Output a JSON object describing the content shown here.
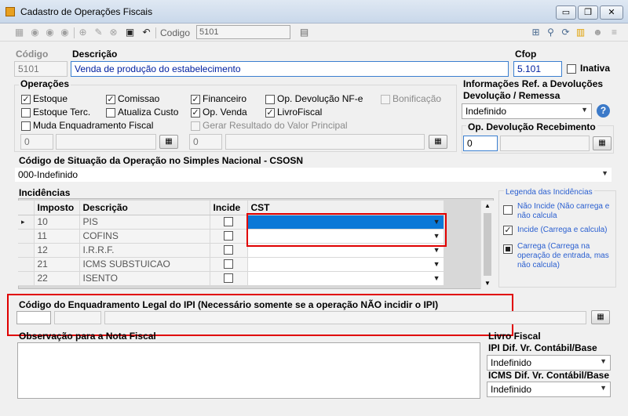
{
  "window": {
    "title": "Cadastro de Operações Fiscais",
    "min": "▭",
    "restore": "❐",
    "close": "✕"
  },
  "toolbar": {
    "search_label": "Codigo",
    "search_value": "5101",
    "icons": [
      "new-icon",
      "edit-icon",
      "delete-icon",
      "save-icon",
      "undo-icon"
    ]
  },
  "header": {
    "codigo_label": "Código",
    "codigo_value": "5101",
    "descricao_label": "Descrição",
    "descricao_value": "Venda de produção do estabelecimento",
    "cfop_label": "Cfop",
    "cfop_value": "5.101",
    "inativa_label": "Inativa"
  },
  "operacoes": {
    "title": "Operações",
    "estoque": "Estoque",
    "estoque_terc": "Estoque Terc.",
    "muda_enquadramento": "Muda Enquadramento Fiscal",
    "comissao": "Comissao",
    "atualiza_custo": "Atualiza Custo",
    "financeiro": "Financeiro",
    "op_venda": "Op. Venda",
    "op_devolucao": "Op. Devolução NF-e",
    "livro_fiscal": "LivroFiscal",
    "bonificacao": "Bonificação",
    "gerar_resultado": "Gerar Resultado do Valor Principal",
    "enq_code": "0",
    "res_code": "0"
  },
  "devolucoes": {
    "title": "Informações Ref. a Devoluções",
    "subtitle": "Devolução / Remessa",
    "select_value": "Indefinido",
    "op_recebimento_label": "Op. Devolução Recebimento",
    "op_recebimento_value": "0"
  },
  "csosn": {
    "label": "Código de Situação da Operação no Simples Nacional - CSOSN",
    "value": "000-Indefinido"
  },
  "incidencias": {
    "title": "Incidências",
    "columns": [
      "Imposto",
      "Descrição",
      "Incide",
      "CST"
    ],
    "rows": [
      {
        "imposto": "10",
        "descricao": "PIS"
      },
      {
        "imposto": "11",
        "descricao": "COFINS"
      },
      {
        "imposto": "12",
        "descricao": "I.R.R.F."
      },
      {
        "imposto": "21",
        "descricao": "ICMS SUBSTUICAO"
      },
      {
        "imposto": "22",
        "descricao": "ISENTO"
      }
    ],
    "row_marker": "▸"
  },
  "legenda": {
    "title": "Legenda das Incidências",
    "nao_incide": "Não Incide (Não carrega e não calcula",
    "incide": "Incide (Carrega e calcula)",
    "carrega": "Carrega (Carrega na operação de entrada, mas não calcula)"
  },
  "ipi": {
    "label": "Código do Enquadramento Legal do IPI (Necessário somente se a operação NÃO incidir o IPI)"
  },
  "observacao": {
    "label": "Observação para a Nota Fiscal"
  },
  "livro_fiscal": {
    "title": "Livro Fiscal",
    "ipi_label": "IPI Dif. Vr. Contábil/Base",
    "ipi_value": "Indefinido",
    "icms_label": "ICMS Dif. Vr. Contábil/Base",
    "icms_value": "Indefinido"
  },
  "colors": {
    "highlight": "#e00000",
    "selection": "#0a78d7",
    "link_text": "#2a5fd0"
  }
}
